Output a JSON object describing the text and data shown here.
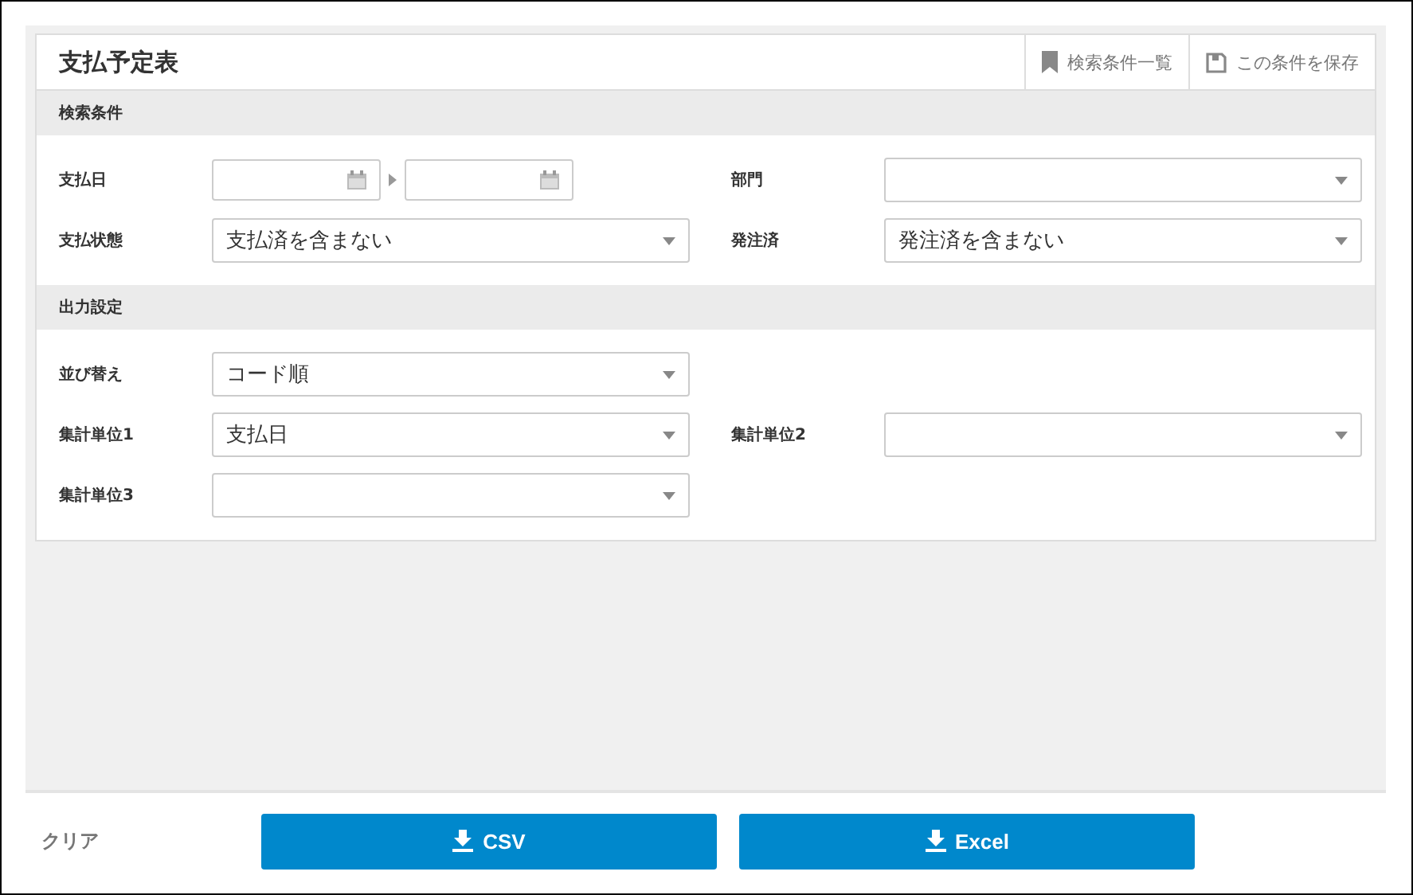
{
  "title": "支払予定表",
  "header_buttons": [
    {
      "kind": "bookmark",
      "label": "検索条件一覧"
    },
    {
      "kind": "save",
      "label": "この条件を保存"
    }
  ],
  "sections": [
    {
      "title": "検索条件",
      "rows": [
        [
          {
            "kind": "date_range",
            "label": "支払日"
          },
          {
            "kind": "select",
            "label": "部門"
          }
        ],
        [
          {
            "kind": "select",
            "label": "支払状態",
            "value": "支払済を含まない"
          },
          {
            "kind": "select",
            "label": "発注済",
            "value": "発注済を含まない"
          }
        ]
      ]
    },
    {
      "title": "出力設定",
      "rows": [
        [
          {
            "kind": "select",
            "label": "並び替え",
            "value": "コード順"
          }
        ],
        [
          {
            "kind": "select",
            "label": "集計単位1",
            "value": "支払日"
          },
          {
            "kind": "select",
            "label": "集計単位2"
          }
        ],
        [
          {
            "kind": "select",
            "label": "集計単位3"
          }
        ]
      ]
    }
  ],
  "footer": {
    "clear": "クリア",
    "buttons": [
      "CSV",
      "Excel"
    ]
  }
}
